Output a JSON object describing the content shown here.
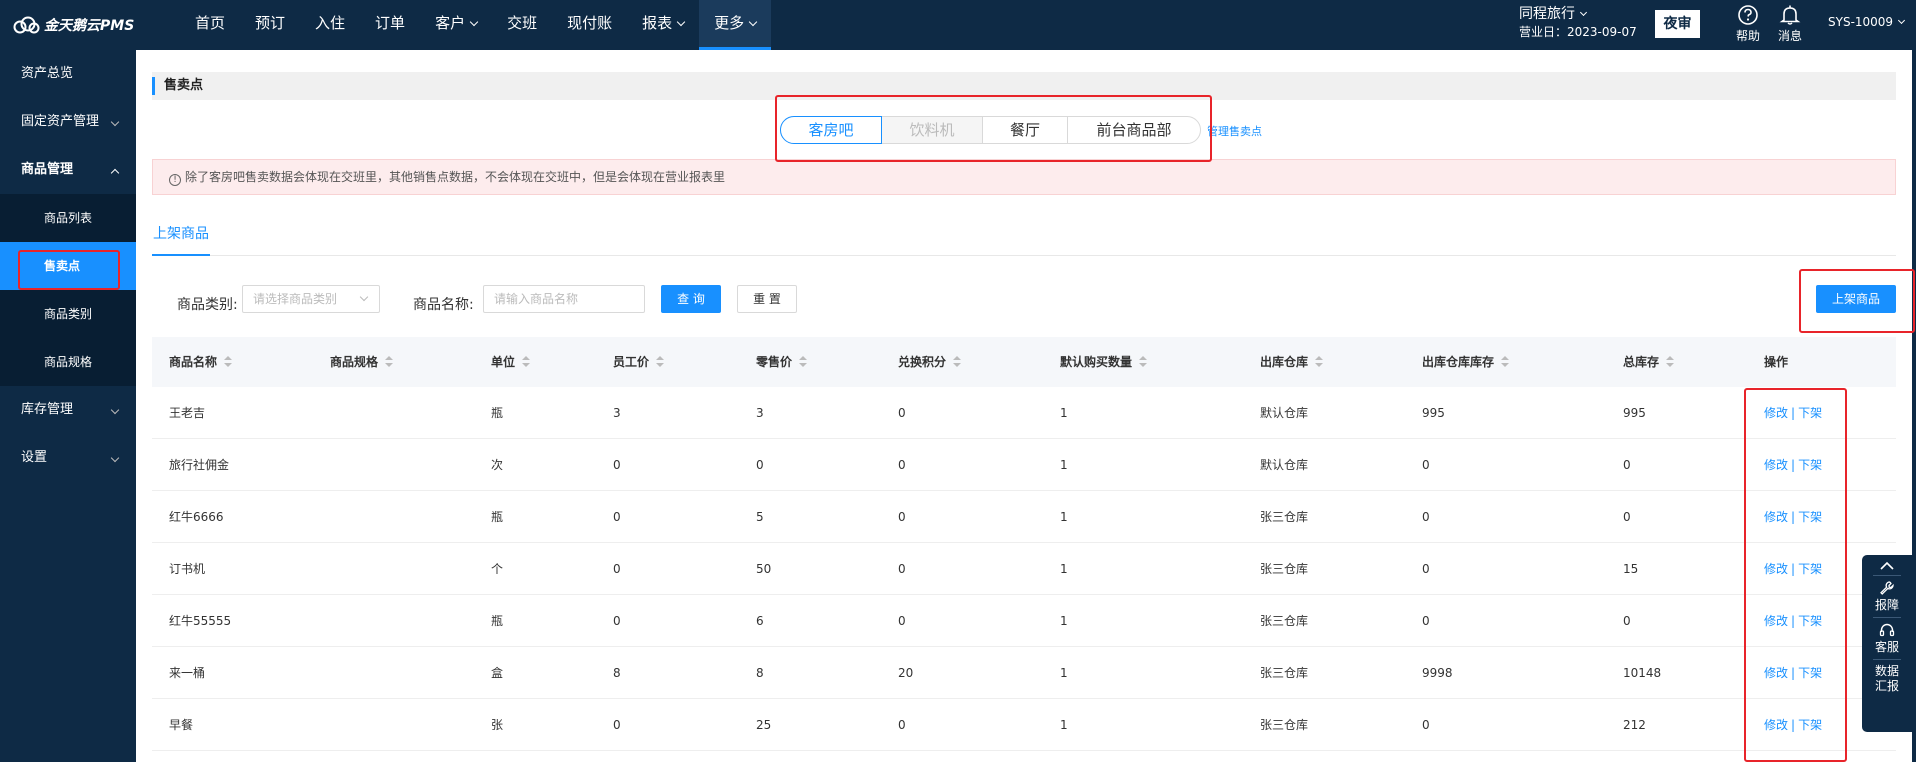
{
  "app": {
    "logo_text": "金天鹅云PMS"
  },
  "nav": [
    {
      "label": "首页"
    },
    {
      "label": "预订"
    },
    {
      "label": "入住"
    },
    {
      "label": "订单"
    },
    {
      "label": "客户"
    },
    {
      "label": "交班"
    },
    {
      "label": "现付账"
    },
    {
      "label": "报表"
    },
    {
      "label": "更多"
    }
  ],
  "header": {
    "hotel_name": "同程旅行",
    "business_date": "营业日：2023-09-07",
    "night_audit": "夜审",
    "help": "帮助",
    "messages": "消息",
    "user": "SYS-10009"
  },
  "sidebar": {
    "items": [
      {
        "label": "资产总览"
      },
      {
        "label": "固定资产管理"
      },
      {
        "label": "商品管理"
      },
      {
        "label": "商品列表"
      },
      {
        "label": "售卖点"
      },
      {
        "label": "商品类别"
      },
      {
        "label": "商品规格"
      },
      {
        "label": "库存管理"
      },
      {
        "label": "设置"
      }
    ]
  },
  "page": {
    "title": "售卖点",
    "segments": [
      {
        "label": "客房吧"
      },
      {
        "label": "饮料机"
      },
      {
        "label": "餐厅"
      },
      {
        "label": "前台商品部"
      }
    ],
    "manage_link": "管理售卖点",
    "alert": "除了客房吧售卖数据会体现在交班里，其他销售点数据，不会体现在交班中，但是会体现在营业报表里",
    "tab": "上架商品",
    "filters": {
      "category_label": "商品类别:",
      "category_placeholder": "请选择商品类别",
      "name_label": "商品名称:",
      "name_placeholder": "请输入商品名称",
      "query": "查 询",
      "reset": "重 置",
      "list_button": "上架商品"
    }
  },
  "table": {
    "columns": [
      "商品名称",
      "商品规格",
      "单位",
      "员工价",
      "零售价",
      "兑换积分",
      "默认购买数量",
      "出库仓库",
      "出库仓库库存",
      "总库存",
      "操作"
    ],
    "rows": [
      {
        "name": "王老吉",
        "spec": "",
        "unit": "瓶",
        "staff_price": "3",
        "retail_price": "3",
        "points": "0",
        "default_qty": "1",
        "warehouse": "默认仓库",
        "wh_stock": "995",
        "total_stock": "995"
      },
      {
        "name": "旅行社佣金",
        "spec": "",
        "unit": "次",
        "staff_price": "0",
        "retail_price": "0",
        "points": "0",
        "default_qty": "1",
        "warehouse": "默认仓库",
        "wh_stock": "0",
        "total_stock": "0"
      },
      {
        "name": "红牛6666",
        "spec": "",
        "unit": "瓶",
        "staff_price": "0",
        "retail_price": "5",
        "points": "0",
        "default_qty": "1",
        "warehouse": "张三仓库",
        "wh_stock": "0",
        "total_stock": "0"
      },
      {
        "name": "订书机",
        "spec": "",
        "unit": "个",
        "staff_price": "0",
        "retail_price": "50",
        "points": "0",
        "default_qty": "1",
        "warehouse": "张三仓库",
        "wh_stock": "0",
        "total_stock": "15"
      },
      {
        "name": "红牛55555",
        "spec": "",
        "unit": "瓶",
        "staff_price": "0",
        "retail_price": "6",
        "points": "0",
        "default_qty": "1",
        "warehouse": "张三仓库",
        "wh_stock": "0",
        "total_stock": "0"
      },
      {
        "name": "来一桶",
        "spec": "",
        "unit": "盒",
        "staff_price": "8",
        "retail_price": "8",
        "points": "20",
        "default_qty": "1",
        "warehouse": "张三仓库",
        "wh_stock": "9998",
        "total_stock": "10148"
      },
      {
        "name": "早餐",
        "spec": "",
        "unit": "张",
        "staff_price": "0",
        "retail_price": "25",
        "points": "0",
        "default_qty": "1",
        "warehouse": "张三仓库",
        "wh_stock": "0",
        "total_stock": "212"
      }
    ],
    "op_edit": "修改",
    "op_sep": "|",
    "op_offshelf": "下架"
  },
  "float_widget": {
    "report": "报障",
    "service": "客服",
    "data1": "数据",
    "data2": "汇报"
  },
  "colors": {
    "nav_bg": "#0e2a45",
    "accent": "#1890ff",
    "highlight": "#e8242a"
  },
  "icons": [
    "cloud-logo-icon",
    "help-icon",
    "bell-icon",
    "chevron-down-icon",
    "chevron-up-icon",
    "info-icon",
    "sort-icon",
    "wrench-icon",
    "headset-icon"
  ]
}
